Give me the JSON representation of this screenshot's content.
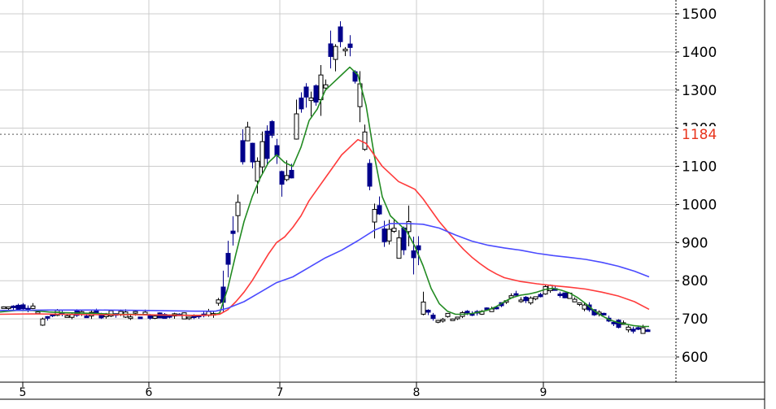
{
  "chart_data": {
    "type": "candlestick",
    "y_ticks": [
      "600",
      "700",
      "800",
      "900",
      "1000",
      "1100",
      "1200",
      "1300",
      "1400",
      "1500"
    ],
    "ylim": [
      530,
      1530
    ],
    "x_ticks": [
      "5",
      "6",
      "7",
      "8",
      "9"
    ],
    "current_price": "1184",
    "grid": true,
    "colors": {
      "up_body": "#ffffff",
      "up_border": "#000000",
      "down_body": "#00008b",
      "ma_short": "#228b22",
      "ma_mid": "#ff3b3b",
      "ma_long": "#4b4bff",
      "price_tag": "#e8341c",
      "grid": "#cccccc"
    },
    "series": [
      {
        "role": "short moving average",
        "x": [
          0,
          20,
          40,
          60,
          80,
          100,
          120,
          140,
          160,
          180,
          200,
          220,
          240,
          260,
          270,
          280,
          290,
          300,
          310,
          320,
          330,
          340,
          350,
          360,
          370,
          380,
          390,
          400,
          410,
          420,
          430,
          440,
          450,
          460,
          470,
          480,
          490,
          500,
          510,
          520,
          530,
          540,
          550,
          560,
          570,
          580,
          590,
          600,
          610,
          620,
          630,
          640,
          650,
          660,
          670,
          680,
          690,
          700,
          710,
          720,
          730,
          740,
          750,
          760,
          770,
          780,
          790,
          798
        ],
        "y": [
          718,
          722,
          722,
          718,
          716,
          715,
          714,
          712,
          712,
          711,
          710,
          710,
          709,
          710,
          715,
          780,
          870,
          955,
          1020,
          1070,
          1110,
          1130,
          1110,
          1100,
          1150,
          1220,
          1250,
          1300,
          1320,
          1340,
          1360,
          1340,
          1260,
          1130,
          1020,
          970,
          950,
          930,
          890,
          840,
          780,
          740,
          720,
          712,
          712,
          714,
          718,
          723,
          732,
          745,
          756,
          762,
          765,
          770,
          777,
          780,
          775,
          768,
          756,
          740,
          722,
          708,
          697,
          690,
          686,
          682,
          680,
          680
        ]
      },
      {
        "role": "mid moving average",
        "x": [
          0,
          40,
          80,
          120,
          160,
          200,
          240,
          260,
          270,
          280,
          290,
          300,
          310,
          320,
          330,
          340,
          350,
          360,
          370,
          380,
          390,
          400,
          410,
          420,
          430,
          440,
          450,
          460,
          470,
          480,
          490,
          500,
          510,
          520,
          530,
          540,
          550,
          560,
          570,
          580,
          590,
          600,
          610,
          620,
          640,
          660,
          680,
          700,
          720,
          740,
          760,
          780,
          798
        ],
        "y": [
          712,
          713,
          712,
          711,
          711,
          710,
          709,
          710,
          712,
          724,
          745,
          770,
          800,
          835,
          870,
          900,
          915,
          940,
          970,
          1010,
          1040,
          1070,
          1100,
          1130,
          1150,
          1170,
          1160,
          1130,
          1100,
          1080,
          1060,
          1050,
          1040,
          1015,
          985,
          955,
          930,
          905,
          882,
          862,
          845,
          830,
          818,
          808,
          798,
          792,
          787,
          783,
          778,
          770,
          760,
          745,
          725
        ]
      },
      {
        "role": "long moving average",
        "x": [
          0,
          60,
          120,
          180,
          240,
          265,
          280,
          300,
          320,
          340,
          360,
          380,
          400,
          420,
          440,
          460,
          480,
          500,
          520,
          540,
          560,
          580,
          600,
          620,
          640,
          660,
          680,
          700,
          720,
          740,
          760,
          780,
          798
        ],
        "y": [
          722,
          723,
          723,
          722,
          720,
          720,
          728,
          745,
          770,
          795,
          810,
          835,
          860,
          880,
          905,
          932,
          950,
          950,
          948,
          938,
          920,
          904,
          893,
          886,
          880,
          872,
          866,
          861,
          856,
          848,
          838,
          825,
          810
        ]
      }
    ]
  }
}
